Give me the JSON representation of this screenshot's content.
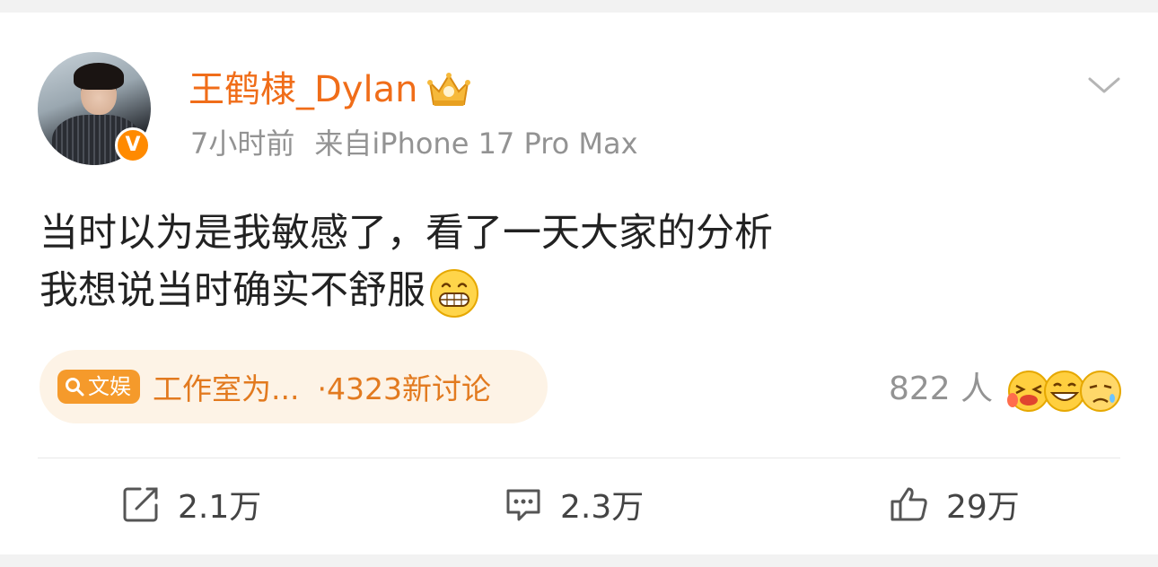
{
  "post": {
    "username": "王鹤棣_Dylan",
    "verified_mark": "V",
    "time": "7小时前",
    "source": "来自iPhone 17 Pro Max",
    "content_line1": "当时以为是我敏感了，看了一天大家的分析",
    "content_line2": "我想说当时确实不舒服"
  },
  "topic": {
    "tag_label": "文娱",
    "text": "工作室为...",
    "count": "·4323新讨论"
  },
  "reactions": {
    "count": "822 人"
  },
  "actions": {
    "repost": "2.1万",
    "comment": "2.3万",
    "like": "29万"
  },
  "colors": {
    "username": "#f06d19",
    "meta": "#939393",
    "topic_bg": "#fdf3e6",
    "topic_text": "#e27a1f",
    "tag_bg": "#f59a2b"
  },
  "icons": [
    "crown-icon",
    "chevron-down-icon",
    "grin-emoji-icon",
    "search-icon",
    "repost-icon",
    "comment-icon",
    "like-icon"
  ]
}
